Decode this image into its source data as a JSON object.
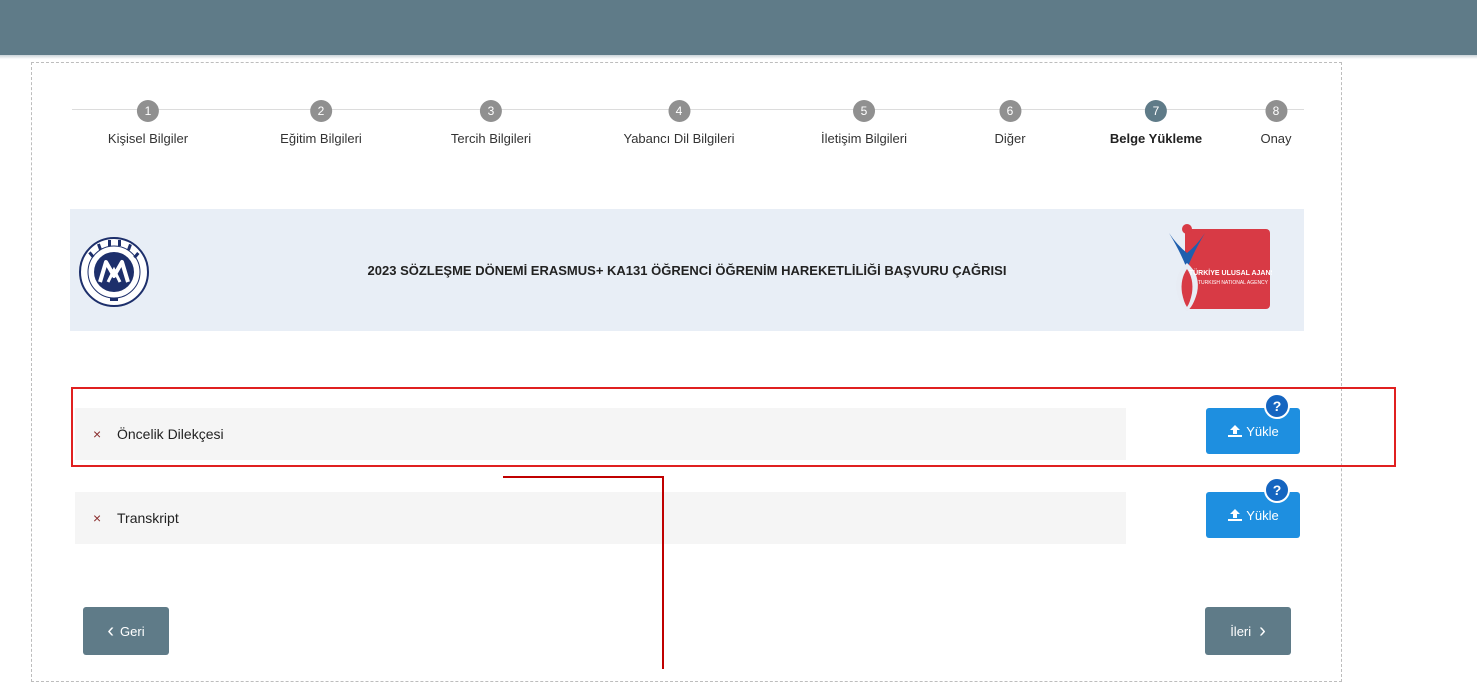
{
  "steps": [
    {
      "number": "1",
      "label": "Kişisel Bilgiler"
    },
    {
      "number": "2",
      "label": "Eğitim Bilgileri"
    },
    {
      "number": "3",
      "label": "Tercih Bilgileri"
    },
    {
      "number": "4",
      "label": "Yabancı Dil Bilgileri"
    },
    {
      "number": "5",
      "label": "İletişim Bilgileri"
    },
    {
      "number": "6",
      "label": "Diğer"
    },
    {
      "number": "7",
      "label": "Belge Yükleme"
    },
    {
      "number": "8",
      "label": "Onay"
    }
  ],
  "active_step": "7",
  "banner": {
    "title": "2023 SÖZLEŞME DÖNEMİ ERASMUS+ KA131 ÖĞRENCİ ÖĞRENİM HAREKETLİLİĞİ BAŞVURU ÇAĞRISI",
    "left_logo": "marmara-university-seal",
    "right_logo": {
      "line1": "TÜRKİYE ULUSAL AJANSI",
      "line2": "TURKISH NATIONAL AGENCY"
    }
  },
  "documents": [
    {
      "status_icon": "x-icon",
      "status_glyph": "×",
      "name": "Öncelik Dilekçesi",
      "upload_label": "Yükle",
      "help_glyph": "?"
    },
    {
      "status_icon": "x-icon",
      "status_glyph": "×",
      "name": "Transkript",
      "upload_label": "Yükle",
      "help_glyph": "?"
    }
  ],
  "nav": {
    "back_label": "Geri",
    "back_icon": "‹",
    "next_label": "İleri",
    "next_icon": "›"
  },
  "colors": {
    "header": "#5f7b88",
    "upload": "#1e8fe0",
    "help": "#1565c0",
    "highlight": "#e02020"
  }
}
